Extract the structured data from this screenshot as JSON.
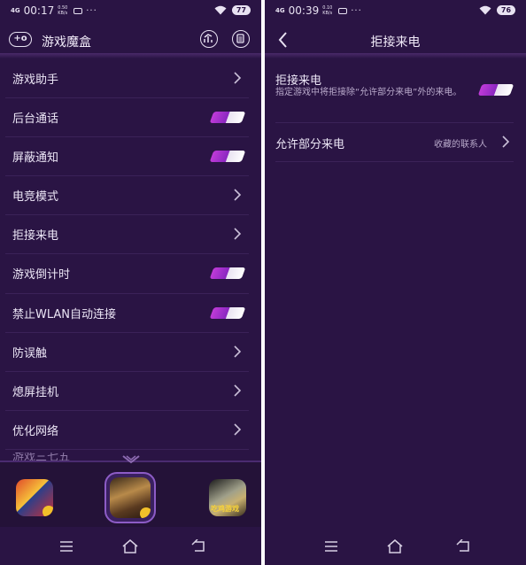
{
  "left_screen": {
    "status": {
      "signal": "4G",
      "time": "00:17",
      "speed": "0.50 KB/s",
      "dots": "···",
      "battery": "77"
    },
    "title": "游戏魔盒",
    "items": [
      {
        "label": "游戏助手",
        "control": "chevron"
      },
      {
        "label": "后台通话",
        "control": "toggle",
        "on": true
      },
      {
        "label": "屏蔽通知",
        "control": "toggle",
        "on": true
      },
      {
        "label": "电竞模式",
        "control": "chevron"
      },
      {
        "label": "拒接来电",
        "control": "chevron"
      },
      {
        "label": "游戏倒计时",
        "control": "toggle",
        "on": true
      },
      {
        "label": "禁止WLAN自动连接",
        "control": "toggle",
        "on": true
      },
      {
        "label": "防误触",
        "control": "chevron"
      },
      {
        "label": "熄屏挂机",
        "control": "chevron"
      },
      {
        "label": "优化网络",
        "control": "chevron"
      }
    ],
    "partial_item": "游戏三七五",
    "tray_games": [
      {
        "name": "game-1",
        "badge": true
      },
      {
        "name": "game-2",
        "badge": true,
        "selected": true
      },
      {
        "name": "game-3",
        "text": "吃鸡游戏"
      }
    ]
  },
  "right_screen": {
    "status": {
      "signal": "4G",
      "time": "00:39",
      "speed": "0.10 KB/s",
      "dots": "···",
      "battery": "76"
    },
    "title": "拒接来电",
    "reject_calls": {
      "label": "拒接来电",
      "description": "指定游戏中将拒接除“允许部分来电”外的来电。",
      "on": true
    },
    "allow_some": {
      "label": "允许部分来电",
      "value": "收藏的联系人"
    }
  },
  "colors": {
    "background": "#2a1444",
    "accent": "#b03ad4",
    "divider": "#3b2258"
  }
}
